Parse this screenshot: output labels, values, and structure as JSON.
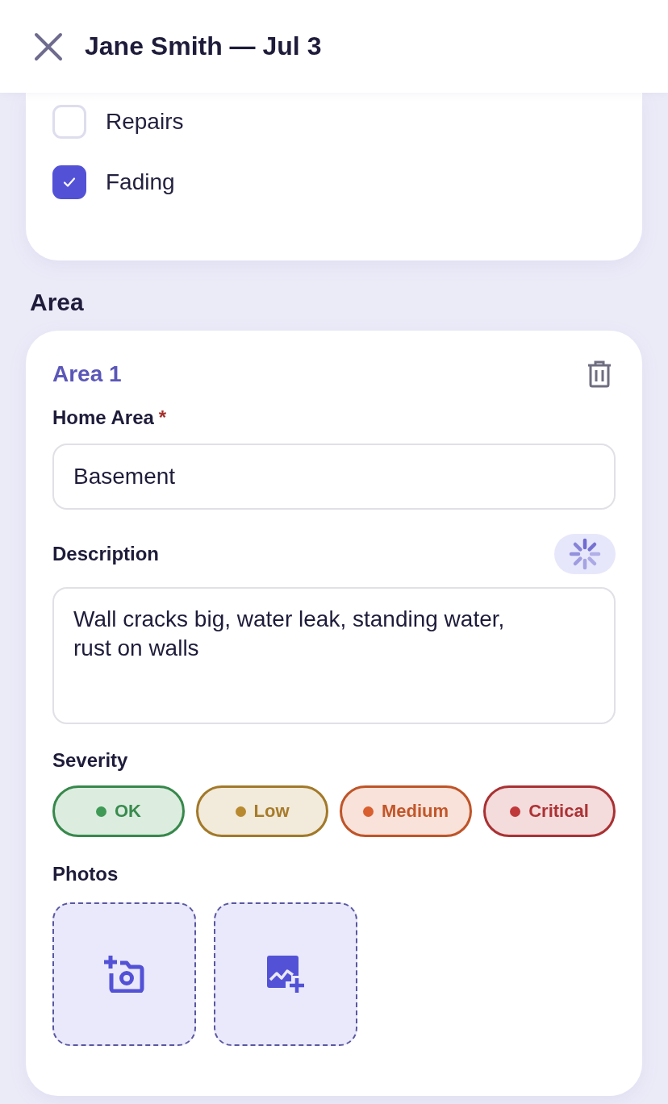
{
  "header": {
    "title": "Jane Smith — Jul 3"
  },
  "checklist": [
    {
      "label": "Repairs",
      "checked": false
    },
    {
      "label": "Fading",
      "checked": true
    }
  ],
  "section_title": "Area",
  "area": {
    "title": "Area 1",
    "home_area": {
      "label": "Home Area",
      "required_mark": "*",
      "value": "Basement"
    },
    "description": {
      "label": "Description",
      "value": "Wall cracks big, water leak, standing water, rust on walls"
    },
    "severity": {
      "label": "Severity",
      "options": [
        {
          "label": "OK",
          "color": "#3f9a55"
        },
        {
          "label": "Low",
          "color": "#b8892f"
        },
        {
          "label": "Medium",
          "color": "#d95f2e"
        },
        {
          "label": "Critical",
          "color": "#c0383a"
        }
      ]
    },
    "photos": {
      "label": "Photos",
      "tiles": [
        {
          "kind": "camera"
        },
        {
          "kind": "gallery"
        }
      ]
    }
  }
}
